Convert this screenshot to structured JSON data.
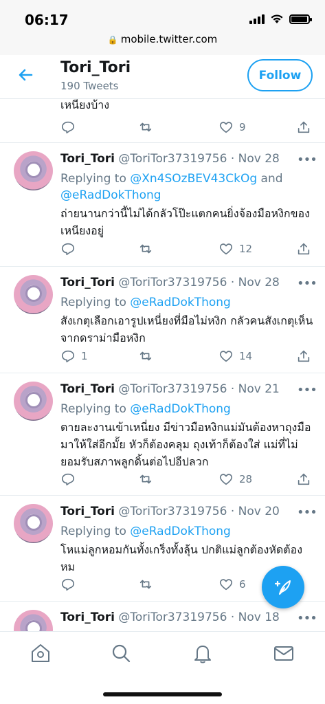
{
  "status_bar": {
    "time": "06:17",
    "battery_level": 0.95
  },
  "browser": {
    "url": "mobile.twitter.com"
  },
  "header": {
    "name": "Tori_Tori",
    "tweet_count": "190 Tweets",
    "follow_label": "Follow"
  },
  "partial_tweet": {
    "text": "เหนียงบ้าง",
    "likes": "9"
  },
  "tweets": [
    {
      "name": "Tori_Tori",
      "handle": "@ToriTor37319756",
      "dot": "·",
      "date": "Nov 28",
      "replying_prefix": "Replying to ",
      "mention1": "@Xn4SOzBEV43CkOg",
      "conj": " and",
      "mention2": "@eRadDokThong",
      "text": "ถ่ายนานกว่านี้ไม่ได้กลัวโป๊ะแตกคนยิ่งจ้องมือหงิกของเหนียงอยู่",
      "replies": "",
      "likes": "12"
    },
    {
      "name": "Tori_Tori",
      "handle": "@ToriTor37319756",
      "dot": "·",
      "date": "Nov 28",
      "replying_prefix": "Replying to ",
      "mention1": "@eRadDokThong",
      "text": "สังเกตุเลือกเอารูปเหนี่ยงที่มือไม่หงิก กลัวคนสังเกตุเห็นจากดราม่ามือหงิก",
      "replies": "1",
      "likes": "14"
    },
    {
      "name": "Tori_Tori",
      "handle": "@ToriTor37319756",
      "dot": "·",
      "date": "Nov 21",
      "replying_prefix": "Replying to ",
      "mention1": "@eRadDokThong",
      "text": "ตายละงานเข้าเหนี่ยง มีข่าวมือหงิกแม่มันต้องหาถุงมือมาให้ใส่อีกมั้ย หัวก็ต้องคลุม ถุงเท้าก็ต้องใส่ แม่ที่ไม่ยอมรับสภาพลูกดิ้นต่อไปอีปลวก",
      "replies": "",
      "likes": "28"
    },
    {
      "name": "Tori_Tori",
      "handle": "@ToriTor37319756",
      "dot": "·",
      "date": "Nov 20",
      "replying_prefix": "Replying to ",
      "mention1": "@eRadDokThong",
      "text": "โหแม่ลูกหอมกันทั้งเกร็งทั้งลุ้น ปกติแม่ลูกต้องหัดต้องหม",
      "replies": "",
      "likes": "6"
    },
    {
      "name": "Tori_Tori",
      "handle": "@ToriTor37319756",
      "dot": "·",
      "date": "Nov 18"
    }
  ],
  "more_glyph": "•••",
  "colors": {
    "accent": "#1da1f2",
    "secondary_text": "#657786",
    "divider": "#e6ecf0"
  }
}
